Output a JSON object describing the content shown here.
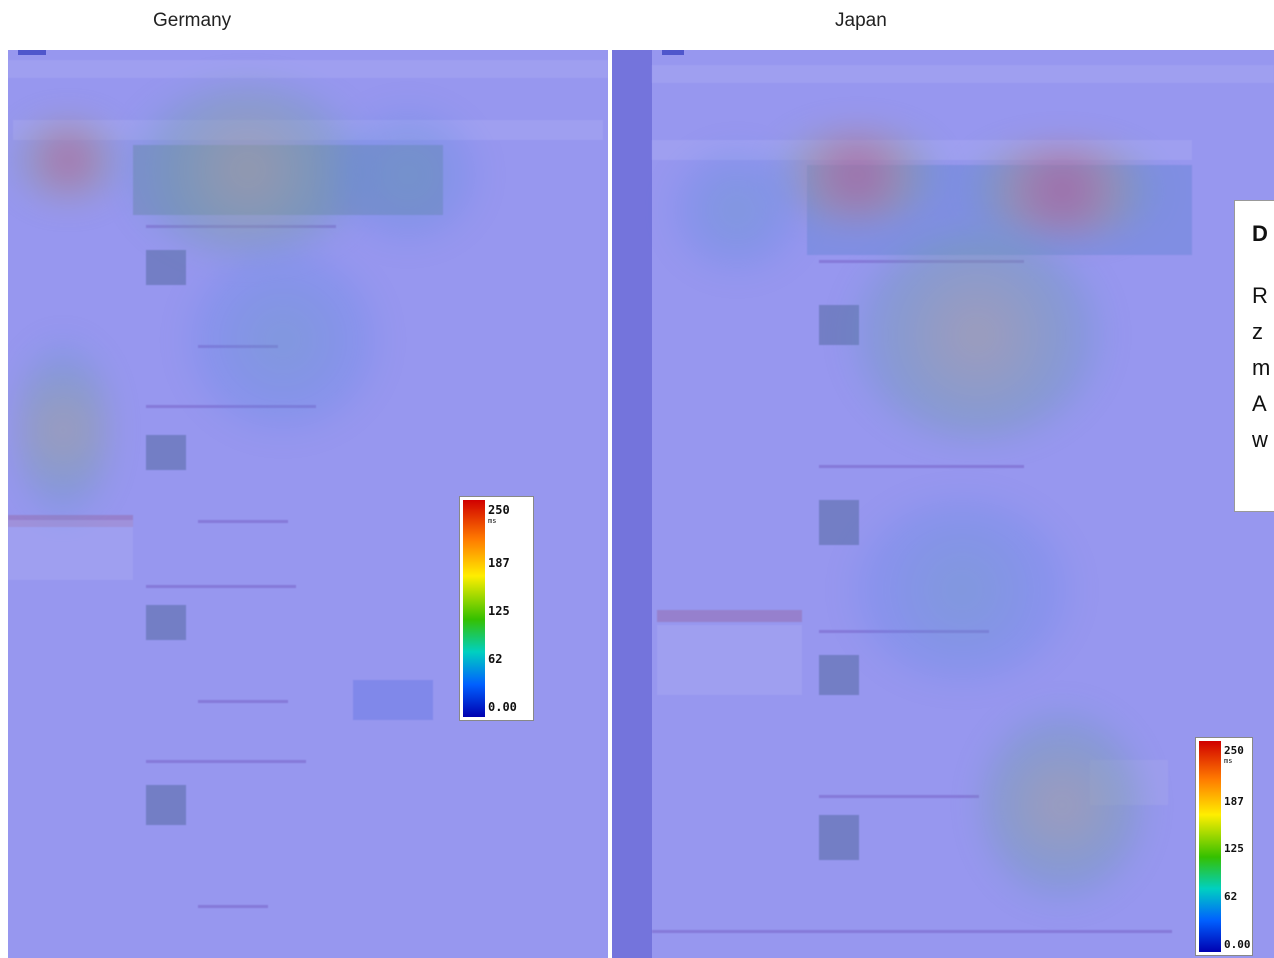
{
  "labels": {
    "left": "Germany",
    "right": "Japan"
  },
  "legend_left": {
    "ticks": [
      "250",
      "187",
      "125",
      "62",
      "0.00"
    ],
    "unit": "ms"
  },
  "legend_right": {
    "ticks": [
      "250",
      "187",
      "125",
      "62",
      "0.00"
    ],
    "unit": "ms"
  },
  "callout": {
    "title": "D",
    "lines": [
      "R",
      "z",
      "m",
      "A",
      "w"
    ]
  },
  "colors": {
    "tint": "#8a8ae8",
    "hot": "#f03c28",
    "frame": "#2a3aa6"
  }
}
